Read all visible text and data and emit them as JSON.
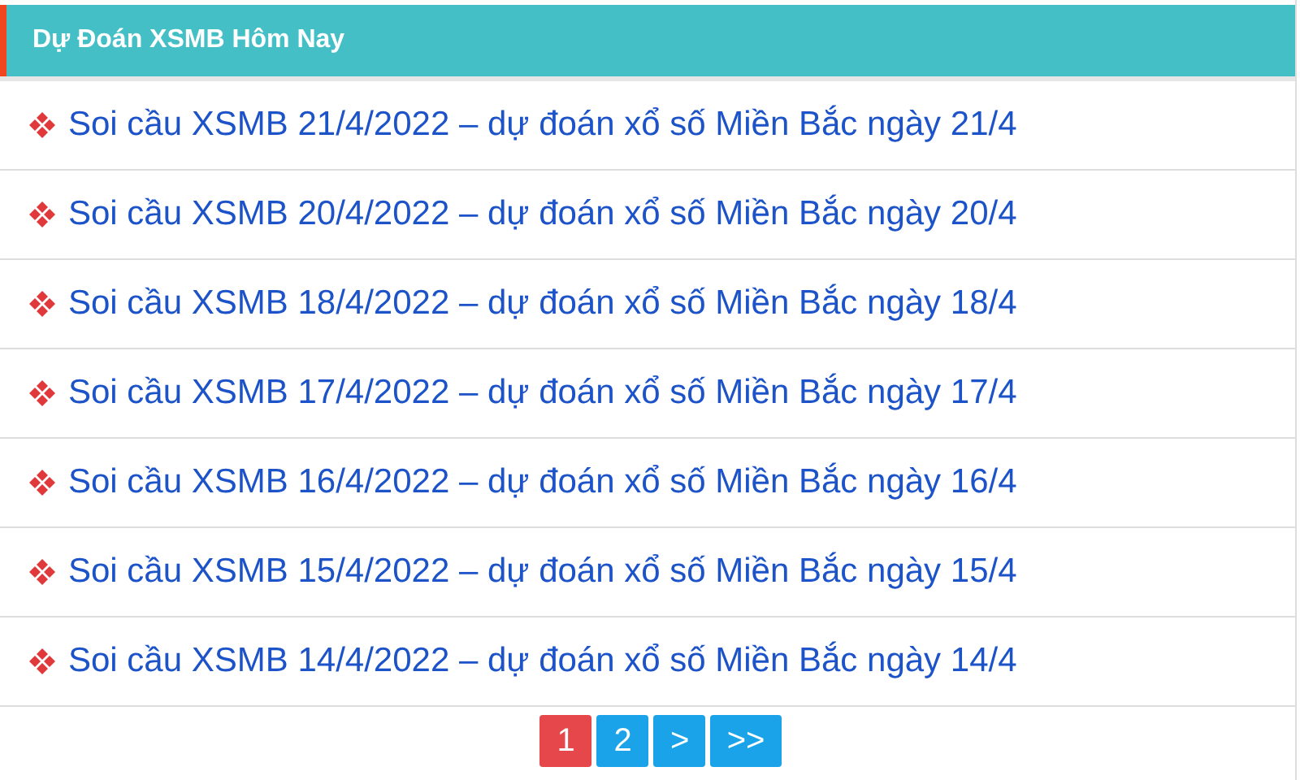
{
  "header": {
    "title": "Dự Đoán XSMB Hôm Nay"
  },
  "articles": [
    {
      "title": "Soi cầu XSMB 21/4/2022 – dự đoán xổ số Miền Bắc ngày 21/4"
    },
    {
      "title": "Soi cầu XSMB 20/4/2022 – dự đoán xổ số Miền Bắc ngày 20/4"
    },
    {
      "title": "Soi cầu XSMB 18/4/2022 – dự đoán xổ số Miền Bắc ngày 18/4"
    },
    {
      "title": "Soi cầu XSMB 17/4/2022 – dự đoán xổ số Miền Bắc ngày 17/4"
    },
    {
      "title": "Soi cầu XSMB 16/4/2022 – dự đoán xổ số Miền Bắc ngày 16/4"
    },
    {
      "title": "Soi cầu XSMB 15/4/2022 – dự đoán xổ số Miền Bắc ngày 15/4"
    },
    {
      "title": "Soi cầu XSMB 14/4/2022 – dự đoán xổ số Miền Bắc ngày 14/4"
    }
  ],
  "pagination": [
    {
      "label": "1",
      "selected": true
    },
    {
      "label": "2",
      "selected": false
    },
    {
      "label": ">",
      "selected": false
    },
    {
      "label": ">>",
      "selected": false
    }
  ]
}
